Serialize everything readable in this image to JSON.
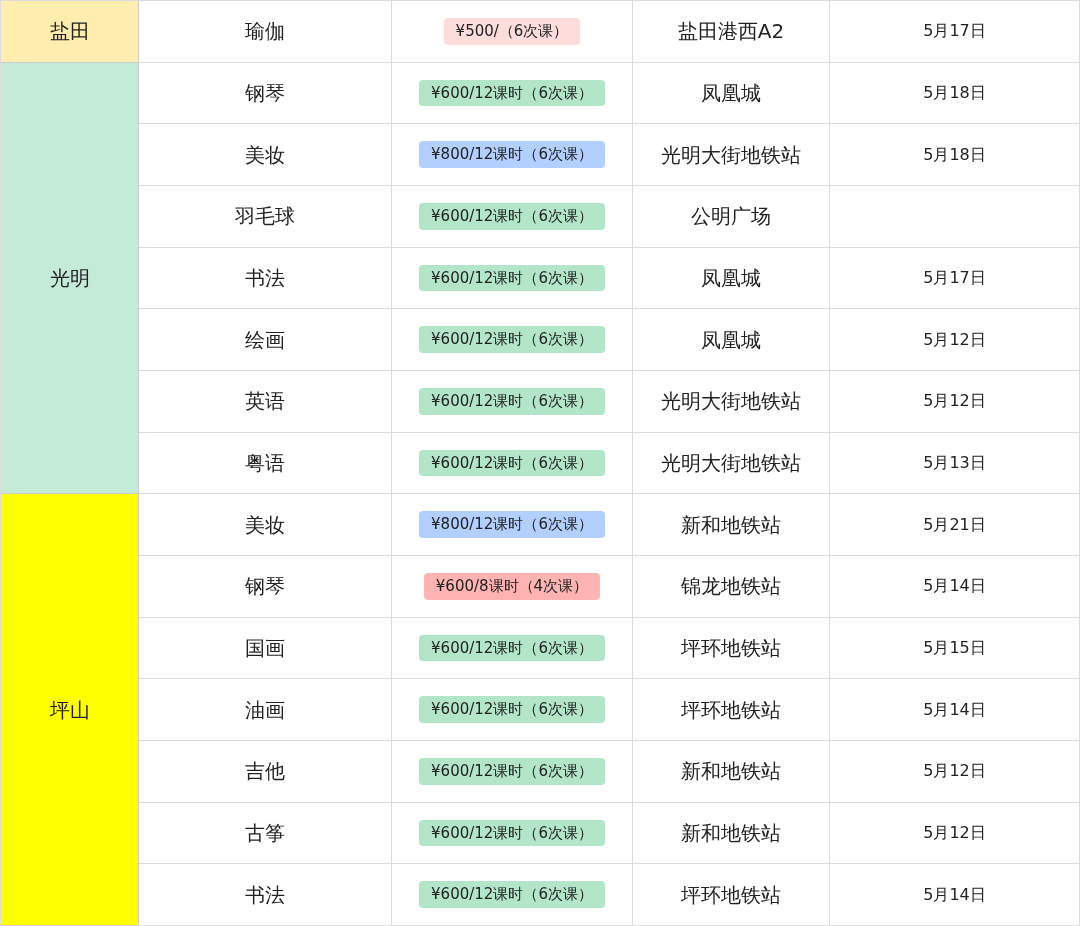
{
  "regions": [
    {
      "name": "盐田",
      "color": "#ffeeb0",
      "rows": [
        {
          "course": "瑜伽",
          "price": {
            "text": "¥500/（6次课）",
            "color": "#fddcdc"
          },
          "location": "盐田港西A2",
          "date": "5月17日"
        }
      ]
    },
    {
      "name": "光明",
      "color": "#c4ead8",
      "rows": [
        {
          "course": "钢琴",
          "price": {
            "text": "¥600/12课时（6次课）",
            "color": "#b3e6c9"
          },
          "location": "凤凰城",
          "date": "5月18日"
        },
        {
          "course": "美妆",
          "price": {
            "text": "¥800/12课时（6次课）",
            "color": "#b3cfff"
          },
          "location": "光明大街地铁站",
          "date": "5月18日"
        },
        {
          "course": "羽毛球",
          "price": {
            "text": "¥600/12课时（6次课）",
            "color": "#b3e6c9"
          },
          "location": "公明广场"
        },
        {
          "course": "书法",
          "price": {
            "text": "¥600/12课时（6次课）",
            "color": "#b3e6c9"
          },
          "location": "凤凰城",
          "date": "5月17日"
        },
        {
          "course": "绘画",
          "price": {
            "text": "¥600/12课时（6次课）",
            "color": "#b3e6c9"
          },
          "location": "凤凰城",
          "date": "5月12日"
        },
        {
          "course": "英语",
          "price": {
            "text": "¥600/12课时（6次课）",
            "color": "#b3e6c9"
          },
          "location": "光明大街地铁站",
          "date": "5月12日"
        },
        {
          "course": "粤语",
          "price": {
            "text": "¥600/12课时（6次课）",
            "color": "#b3e6c9"
          },
          "location": "光明大街地铁站",
          "date": "5月13日"
        }
      ]
    },
    {
      "name": "坪山",
      "color": "#ffff00",
      "rows": [
        {
          "course": "美妆",
          "price": {
            "text": "¥800/12课时（6次课）",
            "color": "#b3cfff"
          },
          "location": "新和地铁站",
          "date": "5月21日"
        },
        {
          "course": "钢琴",
          "price": {
            "text": "¥600/8课时（4次课）",
            "color": "#ffb3b3"
          },
          "location": "锦龙地铁站",
          "date": "5月14日"
        },
        {
          "course": "国画",
          "price": {
            "text": "¥600/12课时（6次课）",
            "color": "#b3e6c9"
          },
          "location": "坪环地铁站",
          "date": "5月15日"
        },
        {
          "course": "油画",
          "price": {
            "text": "¥600/12课时（6次课）",
            "color": "#b3e6c9"
          },
          "location": "坪环地铁站",
          "date": "5月14日"
        },
        {
          "course": "吉他",
          "price": {
            "text": "¥600/12课时（6次课）",
            "color": "#b3e6c9"
          },
          "location": "新和地铁站",
          "date": "5月12日"
        },
        {
          "course": "古筝",
          "price": {
            "text": "¥600/12课时（6次课）",
            "color": "#b3e6c9"
          },
          "location": "新和地铁站",
          "date": "5月12日"
        },
        {
          "course": "书法",
          "price": {
            "text": "¥600/12课时（6次课）",
            "color": "#b3e6c9"
          },
          "location": "坪环地铁站",
          "date": "5月14日"
        }
      ]
    }
  ]
}
